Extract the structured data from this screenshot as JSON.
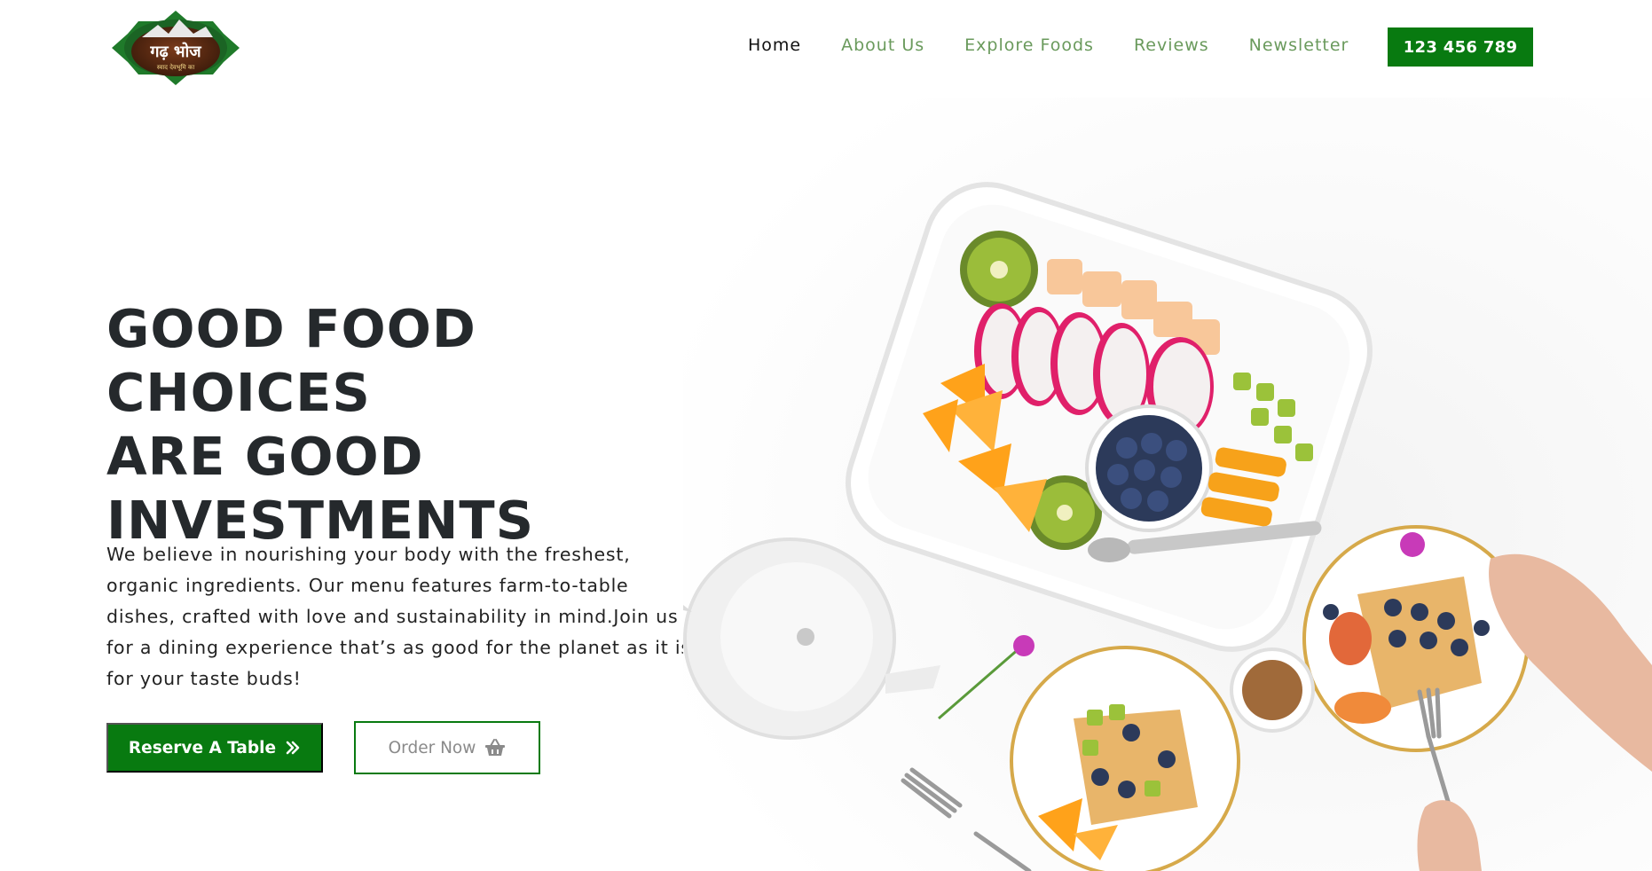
{
  "header": {
    "logo_text": "गढ़ भोज",
    "logo_subtext": "स्वाद देवभूमि का",
    "nav": [
      {
        "label": "Home",
        "active": true
      },
      {
        "label": "About Us",
        "active": false
      },
      {
        "label": "Explore Foods",
        "active": false
      },
      {
        "label": "Reviews",
        "active": false
      },
      {
        "label": "Newsletter",
        "active": false
      }
    ],
    "phone_label": "123 456 789"
  },
  "hero": {
    "title_lines": [
      "GOOD FOOD CHOICES",
      "ARE GOOD",
      "INVESTMENTS"
    ],
    "description": "We believe in nourishing your body with the freshest, organic ingredients. Our menu features farm-to-table dishes, crafted with love and sustainability in mind.Join us for a dining experience that’s as good for the planet as it is for your taste buds!",
    "reserve_label": "Reserve A Table",
    "reserve_icon": "double-chevron-right-icon",
    "order_label": "Order Now",
    "order_icon": "basket-icon"
  },
  "colors": {
    "brand_green": "#087a10",
    "nav_green": "#6a9a5c",
    "title_dark": "#25292c"
  }
}
